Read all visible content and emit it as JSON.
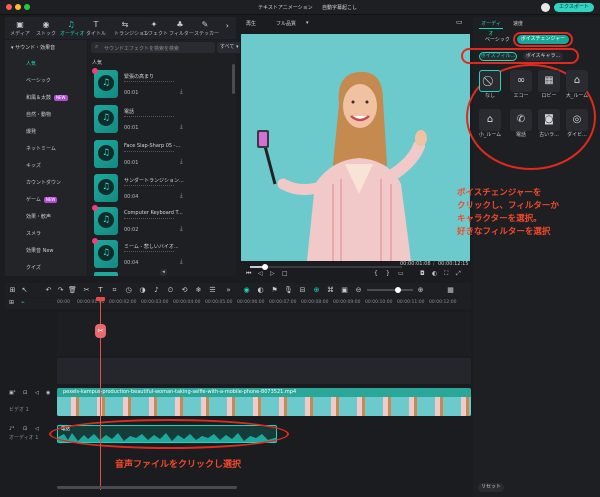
{
  "colors": {
    "accent": "#19d8bd",
    "badge_new": "#b44bd6",
    "annotation": "#e02a1f",
    "export": "#2fd5c2"
  },
  "titlebar": {
    "title": "テキストアニメーション",
    "subtitle": "自動字幕起こし",
    "export_label": "エクスポート"
  },
  "toolbar": {
    "items": [
      {
        "label": "メディア",
        "icon": "media-icon"
      },
      {
        "label": "ストック",
        "icon": "stock-icon"
      },
      {
        "label": "オーディオ",
        "icon": "music-note-icon"
      },
      {
        "label": "タイトル",
        "icon": "title-icon"
      },
      {
        "label": "トランジション",
        "icon": "transition-icon"
      },
      {
        "label": "エフェクト",
        "icon": "effect-icon"
      },
      {
        "label": "フィルター",
        "icon": "filter-icon"
      },
      {
        "label": "ステッカー",
        "icon": "sticker-icon"
      }
    ]
  },
  "sidebar": {
    "header": "サウンド・効果音",
    "items": [
      {
        "label": "人気"
      },
      {
        "label": "ベーシック"
      },
      {
        "label": "和風＆太鼓",
        "badge": "NEW"
      },
      {
        "label": "自然・動物"
      },
      {
        "label": "爆発"
      },
      {
        "label": "ネットミーム"
      },
      {
        "label": "キッズ"
      },
      {
        "label": "カウントダウン"
      },
      {
        "label": "ゲーム",
        "badge": "NEW"
      },
      {
        "label": "効果・歓声"
      },
      {
        "label": "スメラ"
      },
      {
        "label": "効果音 New"
      },
      {
        "label": "クイズ"
      }
    ]
  },
  "library": {
    "search_placeholder": "サウンドエフェクトを検索を検索",
    "filter": "すべて",
    "section": "人気",
    "items": [
      {
        "name": "緊張の高まり",
        "time": "00:01"
      },
      {
        "name": "電話",
        "time": "00:01"
      },
      {
        "name": "Face Slap-Sharp 05 -...",
        "time": "00:01"
      },
      {
        "name": "サンダートランジション...",
        "time": "00:04"
      },
      {
        "name": "Computer Keyboard T...",
        "time": "00:02"
      },
      {
        "name": "ミーム - 悲しいバイオ...",
        "time": "00:04"
      },
      {
        "name": "",
        "time": ""
      }
    ]
  },
  "preview": {
    "tab1": "再生",
    "tab2": "フル品質",
    "time_current": "00:00:01:08",
    "time_total": "00:00:12:15",
    "progress": 0.1
  },
  "right_panel": {
    "tab_audio": "オーディオ",
    "tab_speed": "速度",
    "sub_basic": "ベーシック",
    "sub_voice_changer": "ボイスチェンジャー",
    "chip_filter": "ボイスフィル...",
    "chip_character": "ボイスキャラ...",
    "voices": [
      {
        "label": "なし",
        "icon": "none-icon"
      },
      {
        "label": "エコー",
        "icon": "infinity-icon"
      },
      {
        "label": "ロビー",
        "icon": "lobby-icon"
      },
      {
        "label": "大_ルーム",
        "icon": "large-room-icon"
      },
      {
        "label": "小_ルーム",
        "icon": "small-room-icon"
      },
      {
        "label": "電話",
        "icon": "phone-icon"
      },
      {
        "label": "古いラ...",
        "icon": "old-radio-icon"
      },
      {
        "label": "ダイビ...",
        "icon": "diving-icon"
      }
    ],
    "reset": "リセット"
  },
  "annotations": {
    "right_lines": [
      "ボイスチェンジャーを",
      "クリックし、フィルターか",
      "キャラクターを選択。",
      "好きなフィルターを選択"
    ],
    "bottom": "音声ファイルをクリックし選択"
  },
  "timeline": {
    "ruler": [
      "00:00",
      "00:00:01:00",
      "00:00:02:00",
      "00:00:03:00",
      "00:00:04:00",
      "00:00:05:00",
      "00:00:06:00",
      "00:00:07:00",
      "00:00:08:00",
      "00:00:09:00",
      "00:00:10:00",
      "00:00:11:00",
      "00:00:12:00"
    ],
    "video_clip": "pexels-kampus-production-beautiful-woman-taking-selfie-with-a-mobile-phone-8073521.mp4",
    "audio_clip": "電話",
    "video_track_label": "ビデオ 1",
    "audio_track_label": "オーディオ 1"
  }
}
